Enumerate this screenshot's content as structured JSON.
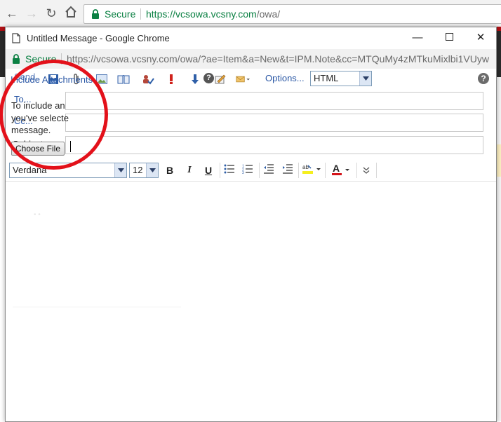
{
  "browser": {
    "secure_label": "Secure",
    "url_host": "https://vcsowa.vcsny.com",
    "url_path": "/owa/"
  },
  "popup": {
    "title": "Untitled Message - Google Chrome",
    "secure_label": "Secure",
    "url": "https://vcsowa.vcsny.com/owa/?ae=Item&a=New&t=IPM.Note&cc=MTQuMy4zMTkuMixlbi1VUyw"
  },
  "toolbar": {
    "send_label": "Send",
    "include_attachments_label": "Include Attachments",
    "options_label": "Options...",
    "format_value": "HTML"
  },
  "compose": {
    "to_label": "To...",
    "cc_label": "Cc...",
    "subject_label": "Subject:",
    "attach_line1": "To include an",
    "attach_line2": "you've selecte",
    "attach_line3": "message.",
    "choose_file_label": "Choose File"
  },
  "formatting": {
    "font_value": "Verdana",
    "size_value": "12",
    "bold": "B",
    "italic": "I",
    "underline": "U",
    "font_color_letter": "A"
  },
  "icons": {
    "reload": "reload-icon",
    "home": "home-icon",
    "lock": "lock-icon"
  },
  "colors": {
    "secure_green": "#0b8043",
    "link_blue": "#2a57a5",
    "annotation_red": "#e3111a"
  }
}
